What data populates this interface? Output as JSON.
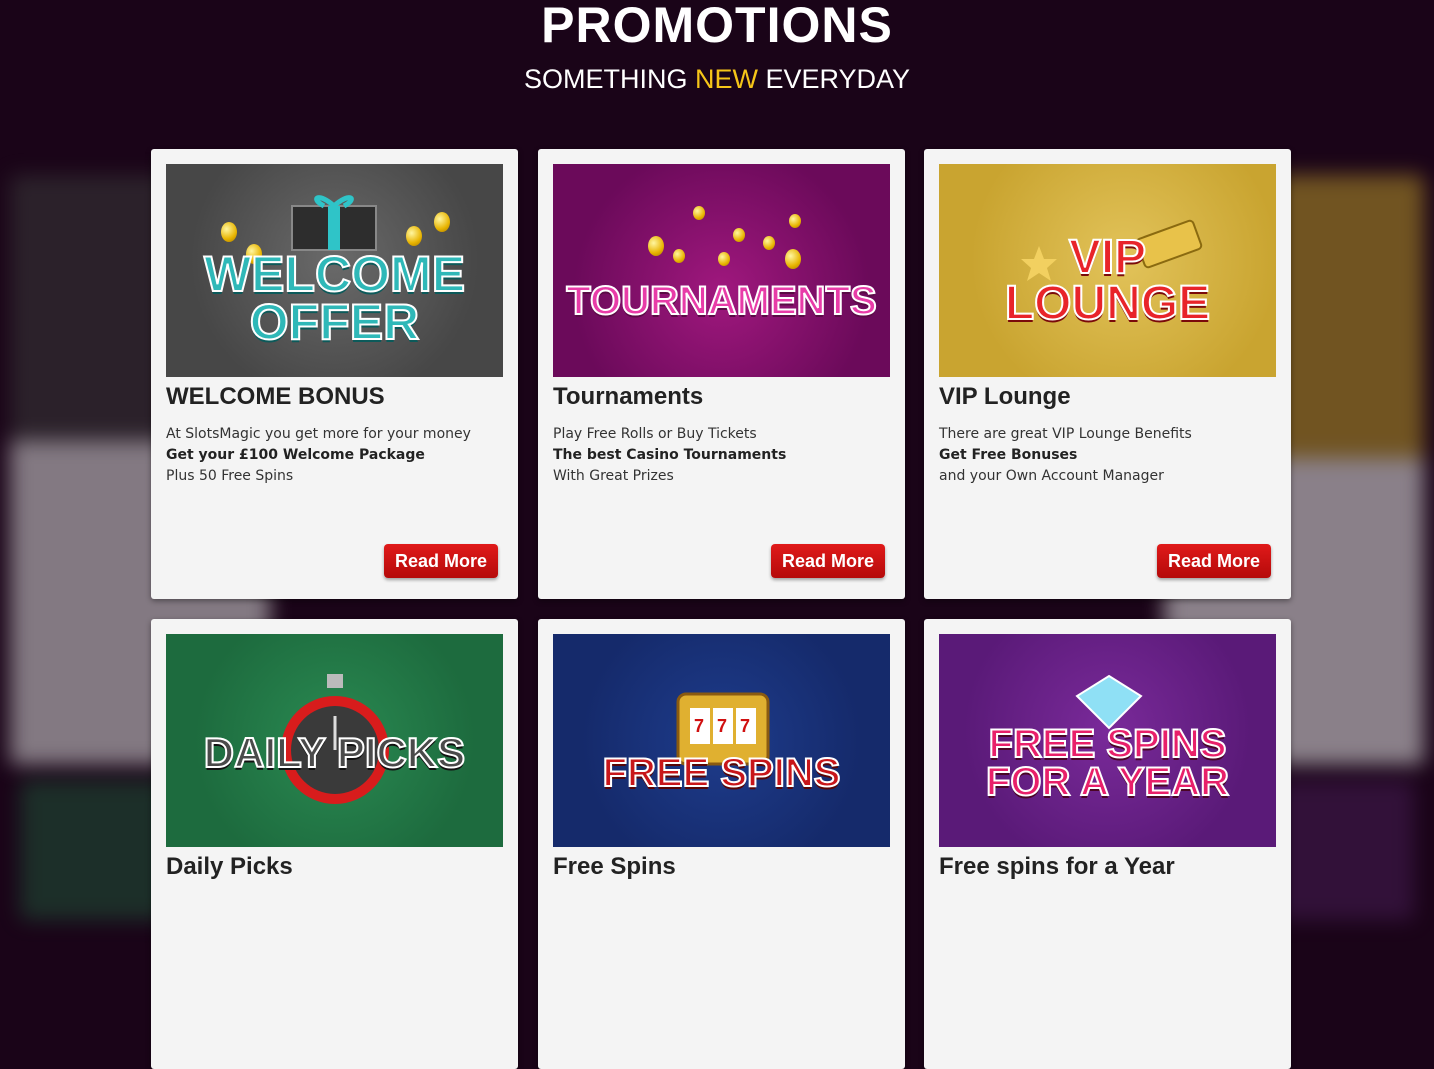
{
  "header": {
    "title": "PROMOTIONS",
    "subtitle_part1": "SOMETHING ",
    "subtitle_accent": "NEW",
    "subtitle_part2": " EVERYDAY"
  },
  "cards": [
    {
      "image_text_line1": "WELCOME",
      "image_text_line2": "OFFER",
      "image_bg": "#474747",
      "title": "WELCOME BONUS",
      "line1": "At SlotsMagic you get more for your money",
      "line2": "Get your £100 Welcome Package",
      "line3": "Plus 50 Free Spins",
      "button": "Read More"
    },
    {
      "image_text_line1": "TOURNAMENTS",
      "image_bg": "#6b0a5a",
      "title": "Tournaments",
      "line1": "Play Free Rolls or Buy Tickets",
      "line2": "The best Casino Tournaments",
      "line3": "With Great Prizes",
      "button": "Read More"
    },
    {
      "image_text_line1": "VIP",
      "image_text_line2": "LOUNGE",
      "image_bg": "#c9a430",
      "title": "VIP Lounge",
      "line1": "There are great VIP Lounge Benefits",
      "line2": "Get Free Bonuses",
      "line3": "and your Own Account Manager",
      "button": "Read More"
    },
    {
      "image_text_line1": "DAILY PICKS",
      "image_bg": "#1d6b3e",
      "title": "Daily Picks"
    },
    {
      "image_text_line1": "FREE SPINS",
      "image_bg": "#152a6b",
      "title": "Free Spins"
    },
    {
      "image_text_line1": "FREE SPINS",
      "image_text_line2": "FOR A YEAR",
      "image_bg": "#5a1a78",
      "title": "Free spins for a Year"
    }
  ]
}
